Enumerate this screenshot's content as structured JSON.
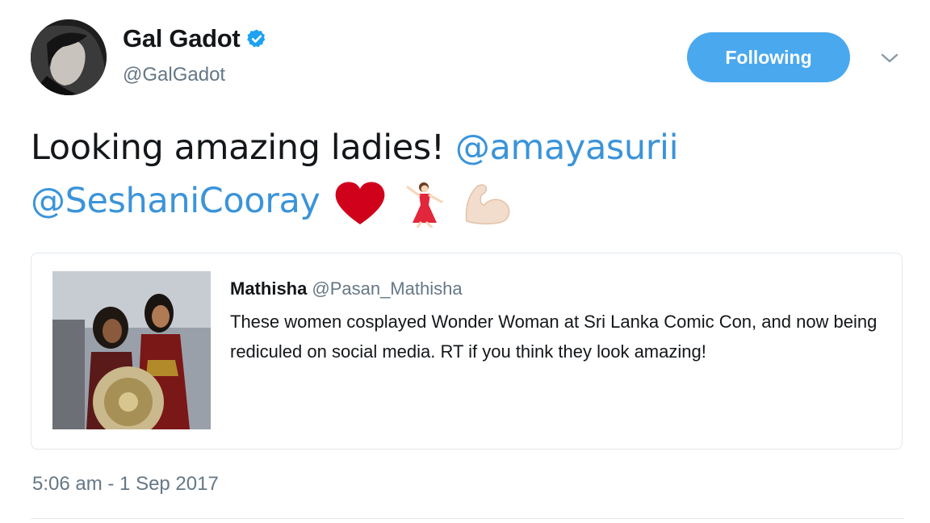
{
  "author": {
    "display_name": "Gal Gadot",
    "handle": "@GalGadot",
    "verified": true,
    "avatar_icon": "profile-photo"
  },
  "actions": {
    "follow_label": "Following",
    "menu_icon": "chevron-down-icon"
  },
  "tweet": {
    "text_start": "Looking amazing ladies! ",
    "mention_1": "@amayasurii",
    "mention_2": "@SeshaniCooray",
    "emojis": [
      "red-heart",
      "woman-dancing",
      "flexed-biceps"
    ],
    "timestamp": "5:06 am - 1 Sep 2017"
  },
  "quoted_tweet": {
    "name": "Mathisha",
    "handle": "@Pasan_Mathisha",
    "text": "These women cosplayed Wonder Woman at Sri Lanka Comic Con, and now being rediculed on social media. RT if you think they look amazing!",
    "image_icon": "cosplay-photo"
  },
  "colors": {
    "accent": "#4aa8ee",
    "mention": "#3b94d9",
    "muted": "#657786",
    "heart": "#d0021b"
  }
}
